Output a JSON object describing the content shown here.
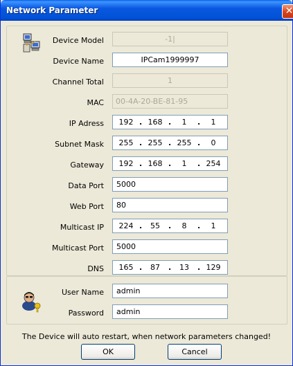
{
  "window": {
    "title": "Network Parameter"
  },
  "fields": {
    "device_model": {
      "label": "Device Model",
      "value": "-1|"
    },
    "device_name": {
      "label": "Device Name",
      "value": "IPCam1999997"
    },
    "channel_total": {
      "label": "Channel Total",
      "value": "1"
    },
    "mac": {
      "label": "MAC",
      "value": "00-4A-20-BE-81-95"
    },
    "ip_address": {
      "label": "IP Adress",
      "octets": [
        "192",
        "168",
        "1",
        "1"
      ]
    },
    "subnet_mask": {
      "label": "Subnet Mask",
      "octets": [
        "255",
        "255",
        "255",
        "0"
      ]
    },
    "gateway": {
      "label": "Gateway",
      "octets": [
        "192",
        "168",
        "1",
        "254"
      ]
    },
    "data_port": {
      "label": "Data Port",
      "value": "5000"
    },
    "web_port": {
      "label": "Web Port",
      "value": "80"
    },
    "multicast_ip": {
      "label": "Multicast IP",
      "octets": [
        "224",
        "55",
        "8",
        "1"
      ]
    },
    "multicast_port": {
      "label": "Multicast  Port",
      "value": "5000"
    },
    "dns": {
      "label": "DNS",
      "octets": [
        "165",
        "87",
        "13",
        "129"
      ]
    }
  },
  "login": {
    "user_name": {
      "label": "User Name",
      "value": "admin"
    },
    "password": {
      "label": "Password",
      "value": "admin"
    }
  },
  "ip_separator": ".",
  "message": "The Device will auto restart, when network parameters changed!",
  "buttons": {
    "ok": "OK",
    "cancel": "Cancel"
  },
  "icons": {
    "close": "close-icon",
    "network": "network-computers-icon",
    "user": "user-key-icon"
  }
}
